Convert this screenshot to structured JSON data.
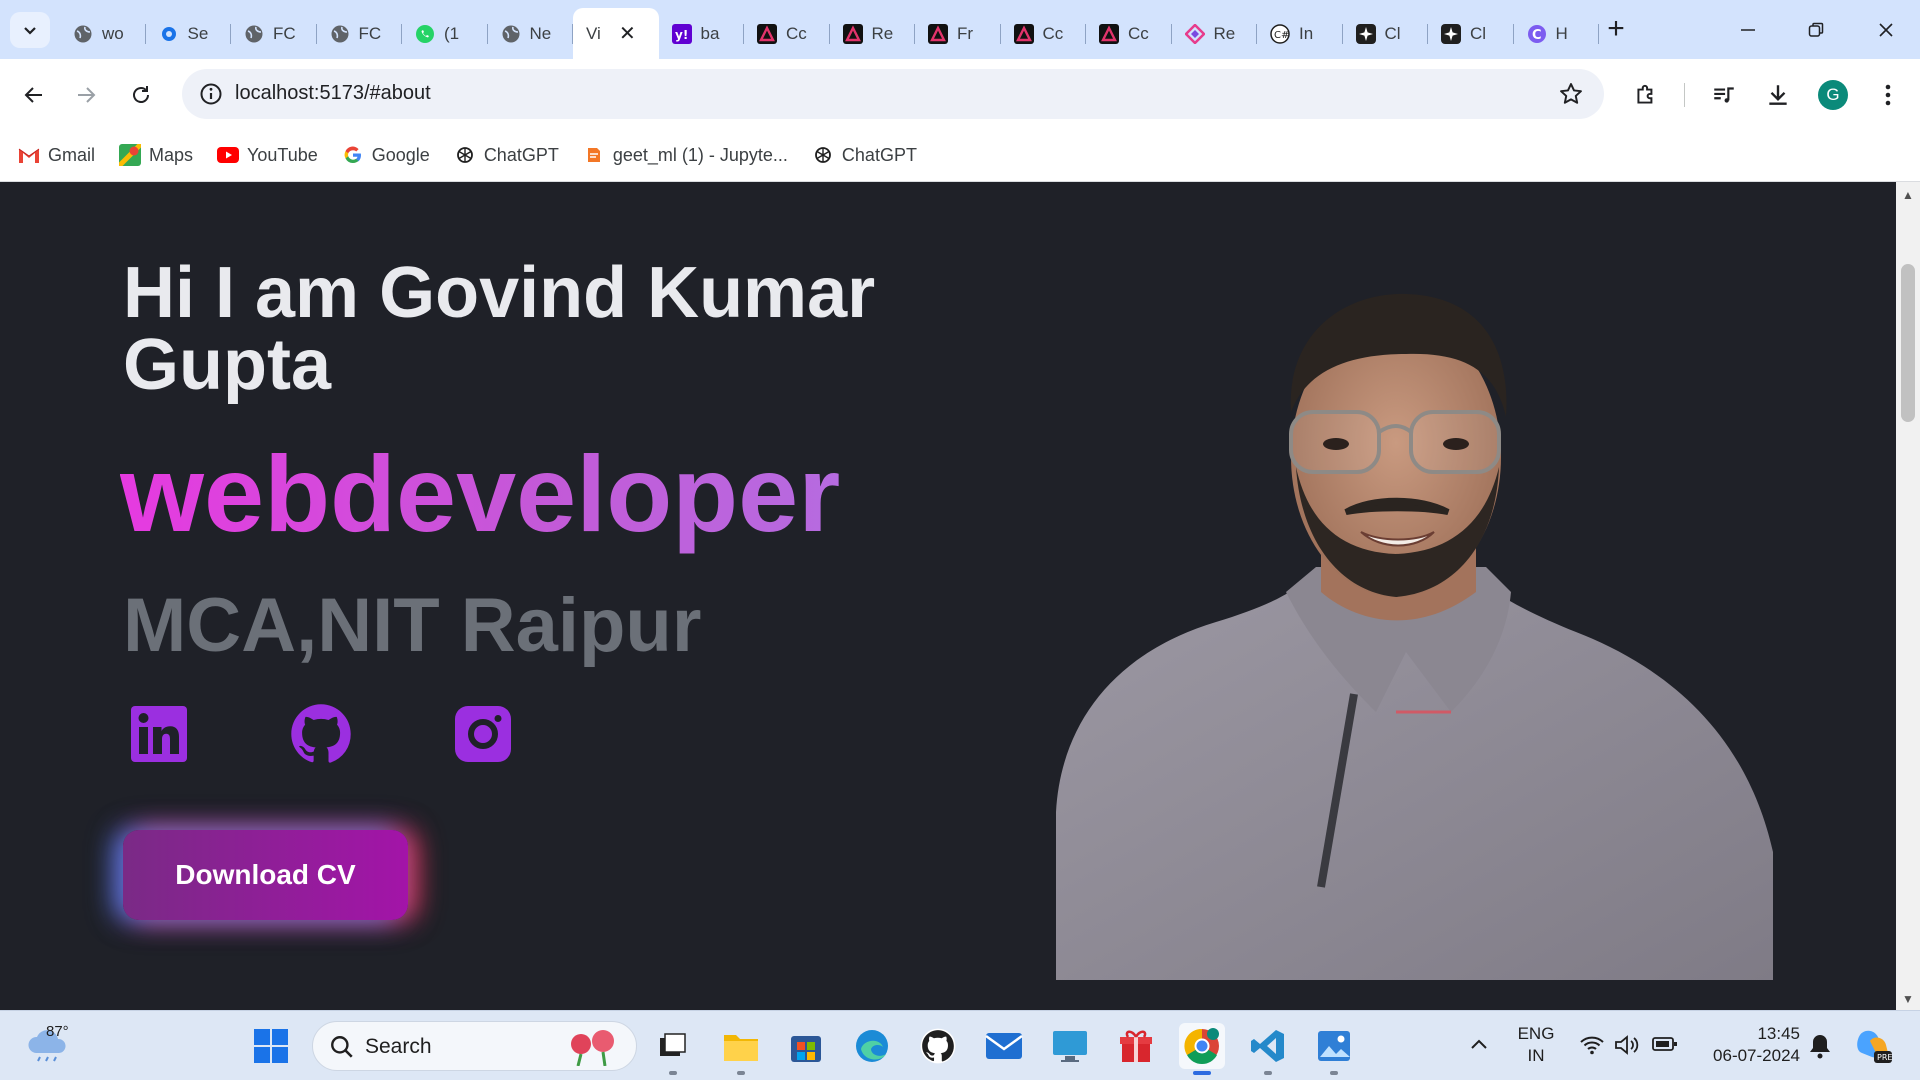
{
  "browser": {
    "tabs": [
      {
        "title": "wo",
        "icon": "globe-icon"
      },
      {
        "title": "Se",
        "icon": "gear-icon"
      },
      {
        "title": "FC",
        "icon": "globe-icon"
      },
      {
        "title": "FC",
        "icon": "globe-icon"
      },
      {
        "title": "(1",
        "icon": "whatsapp-icon"
      },
      {
        "title": "Ne",
        "icon": "globe-icon"
      },
      {
        "title": "Vi",
        "icon": "none",
        "active": true
      },
      {
        "title": "ba",
        "icon": "yahoo-icon"
      },
      {
        "title": "Cc",
        "icon": "app-a-icon"
      },
      {
        "title": "Re",
        "icon": "app-a-icon"
      },
      {
        "title": "Fr",
        "icon": "app-a-icon"
      },
      {
        "title": "Cc",
        "icon": "app-a-icon"
      },
      {
        "title": "Cc",
        "icon": "app-a-icon"
      },
      {
        "title": "Re",
        "icon": "diamond-icon"
      },
      {
        "title": "In",
        "icon": "copilot-icon"
      },
      {
        "title": "Cl",
        "icon": "sparkle-icon"
      },
      {
        "title": "Cl",
        "icon": "sparkle-icon"
      },
      {
        "title": "H",
        "icon": "c-icon"
      }
    ],
    "url": "localhost:5173/#about",
    "profile_initial": "G",
    "bookmarks": [
      {
        "label": "Gmail",
        "icon": "gmail-icon"
      },
      {
        "label": "Maps",
        "icon": "maps-icon"
      },
      {
        "label": "YouTube",
        "icon": "youtube-icon"
      },
      {
        "label": "Google",
        "icon": "google-icon"
      },
      {
        "label": "ChatGPT",
        "icon": "openai-icon"
      },
      {
        "label": "geet_ml (1) - Jupyte...",
        "icon": "jupyter-icon"
      },
      {
        "label": "ChatGPT",
        "icon": "openai-icon"
      }
    ]
  },
  "hero": {
    "name": "Hi I am Govind Kumar Gupta",
    "role": "webdeveloper",
    "education": "MCA,NIT Raipur",
    "cv_button": "Download CV",
    "socials": [
      "linkedin-icon",
      "github-icon",
      "instagram-icon"
    ],
    "accent_color": "#9b2fe0"
  },
  "taskbar": {
    "weather_temp": "87°",
    "search_placeholder": "Search",
    "lang_line1": "ENG",
    "lang_line2": "IN",
    "time": "13:45",
    "date": "06-07-2024"
  }
}
